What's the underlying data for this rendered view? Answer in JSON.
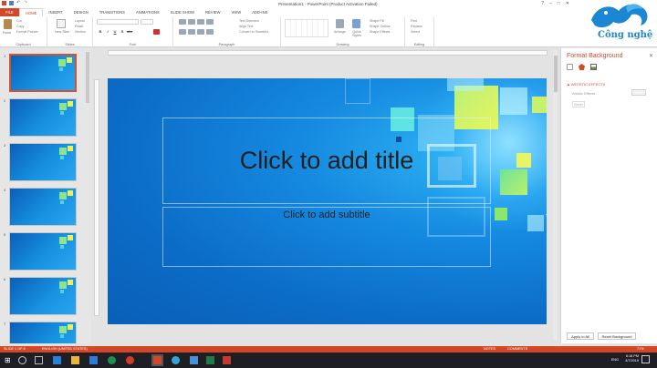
{
  "window": {
    "title": "Presentation1 - PowerPoint (Product Activation Failed)",
    "controls": [
      "?",
      "–",
      "□",
      "✕"
    ]
  },
  "ribbon_tabs": [
    "FILE",
    "HOME",
    "INSERT",
    "DESIGN",
    "TRANSITIONS",
    "ANIMATIONS",
    "SLIDE SHOW",
    "REVIEW",
    "VIEW",
    "ADD-INS"
  ],
  "ribbon": {
    "clipboard": {
      "label": "Clipboard",
      "paste": "Paste",
      "cut": "Cut",
      "copy": "Copy",
      "format_painter": "Format Painter"
    },
    "slides": {
      "label": "Slides",
      "new_slide": "New Slide",
      "layout": "Layout",
      "reset": "Reset",
      "section": "Section"
    },
    "font": {
      "label": "Font",
      "bold": "B",
      "italic": "I",
      "underline": "U",
      "shadow": "S",
      "strike": "abc"
    },
    "paragraph": {
      "label": "Paragraph",
      "text_direction": "Text Direction",
      "align_text": "Align Text",
      "smartart": "Convert to SmartArt"
    },
    "drawing": {
      "label": "Drawing",
      "arrange": "Arrange",
      "quick_styles": "Quick Styles",
      "shape_fill": "Shape Fill",
      "shape_outline": "Shape Outline",
      "shape_effects": "Shape Effects"
    },
    "editing": {
      "label": "Editing",
      "find": "Find",
      "replace": "Replace",
      "select": "Select"
    }
  },
  "thumbnails": [
    "1",
    "2",
    "3",
    "4",
    "5",
    "6",
    "7"
  ],
  "slide": {
    "title_placeholder": "Click to add title",
    "subtitle_placeholder": "Click to add subtitle"
  },
  "format_pane": {
    "title": "Format Background",
    "section": "ARTISTIC EFFECTS",
    "artistic_effects_label": "Artistic Effects",
    "reset_label": "Reset",
    "apply_all": "Apply to All",
    "reset_background": "Reset Background"
  },
  "status_bar": {
    "slide_info": "SLIDE 1 OF 8",
    "language": "ENGLISH (UNITED STATES)",
    "notes": "NOTES",
    "comments": "COMMENTS",
    "zoom": "71%"
  },
  "taskbar": {
    "time": "6:18 PM",
    "date": "4/7/2019",
    "lang": "ENG"
  },
  "watermark": {
    "text": "Công nghệ"
  },
  "colors": {
    "accent": "#d24726",
    "taskbar": "#1e1f24",
    "slide_blue": "#1589e0"
  }
}
